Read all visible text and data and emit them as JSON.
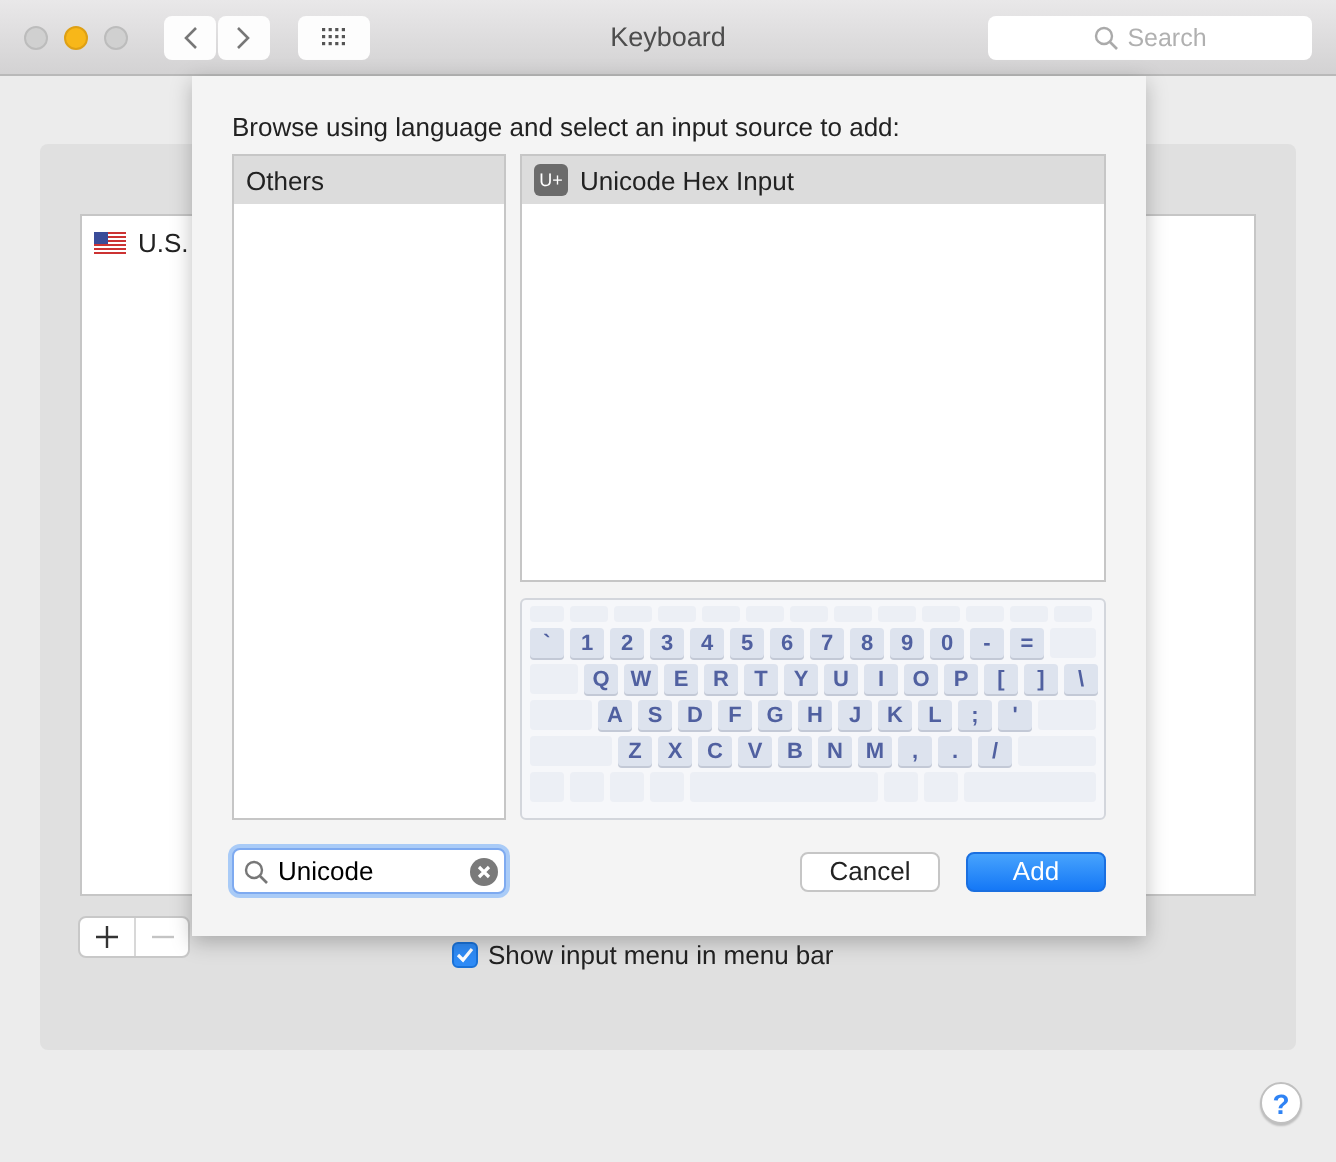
{
  "window": {
    "title": "Keyboard",
    "search": {
      "placeholder": "Search"
    }
  },
  "input_sources": {
    "items": [
      {
        "label": "U.S.",
        "selected": false
      }
    ],
    "add_enabled": true,
    "remove_enabled": false
  },
  "show_input_menu": {
    "label": "Show input menu in menu bar",
    "checked": true
  },
  "sheet": {
    "heading": "Browse using language and select an input source to add:",
    "languages": [
      {
        "label": "Others",
        "selected": true
      }
    ],
    "sources": [
      {
        "badge": "U+",
        "label": "Unicode Hex Input",
        "selected": true
      }
    ],
    "keyboard": [
      [
        "`",
        "1",
        "2",
        "3",
        "4",
        "5",
        "6",
        "7",
        "8",
        "9",
        "0",
        "-",
        "="
      ],
      [
        "Q",
        "W",
        "E",
        "R",
        "T",
        "Y",
        "U",
        "I",
        "O",
        "P",
        "[",
        "]",
        "\\"
      ],
      [
        "A",
        "S",
        "D",
        "F",
        "G",
        "H",
        "J",
        "K",
        "L",
        ";",
        "'"
      ],
      [
        "Z",
        "X",
        "C",
        "V",
        "B",
        "N",
        "M",
        ",",
        ".",
        "/"
      ]
    ],
    "search": {
      "value": "Unicode"
    },
    "buttons": [
      {
        "label": "Cancel",
        "kind": "secondary"
      },
      {
        "label": "Add",
        "kind": "default"
      }
    ]
  },
  "help": {
    "label": "?"
  }
}
